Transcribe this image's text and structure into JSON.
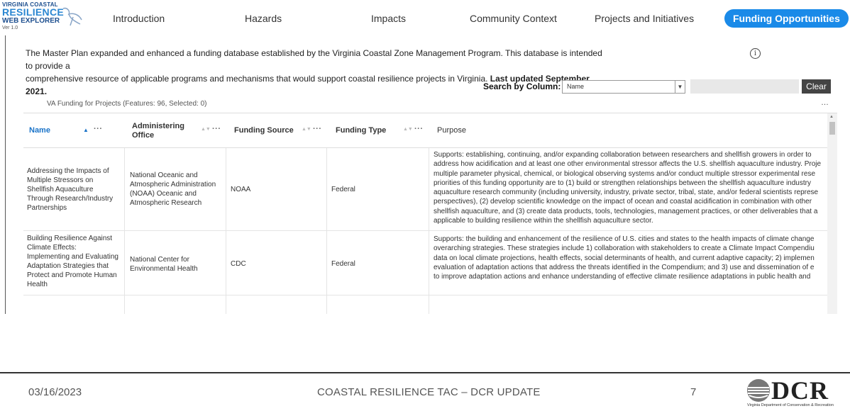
{
  "logo": {
    "line1": "VIRGINIA COASTAL",
    "line2": "RESILIENCE",
    "line3": "WEB EXPLORER",
    "version": "Ver 1.0"
  },
  "nav": {
    "tabs": [
      {
        "label": "Introduction"
      },
      {
        "label": "Hazards"
      },
      {
        "label": "Impacts"
      },
      {
        "label": "Community Context"
      },
      {
        "label": "Projects and Initiatives"
      },
      {
        "label": "Funding Opportunities",
        "active": true
      }
    ]
  },
  "intro": {
    "line1": "The Master Plan expanded and enhanced a funding database established by the Virginia Coastal Zone Management Program. This database is intended to provide a",
    "line2": "comprehensive resource of applicable programs and mechanisms that would support coastal resilience projects in Virginia.",
    "updated": "Last updated September 2021."
  },
  "info_icon": "info-icon",
  "search": {
    "label": "Search by Column:",
    "selected": "Name",
    "query": "",
    "clear_label": "Clear"
  },
  "table": {
    "feature_label": "VA Funding for Projects (Features: 96, Selected: 0)",
    "more_label": "…",
    "columns": [
      {
        "label": "Name",
        "sorted": "ascending"
      },
      {
        "label": "Administering Office"
      },
      {
        "label": "Funding Source"
      },
      {
        "label": "Funding Type"
      },
      {
        "label": "Purpose"
      }
    ],
    "rows": [
      {
        "name": "Addressing the Impacts of Multiple Stressors on Shellfish Aquaculture Through Research/Industry Partnerships",
        "office": "National Oceanic and Atmospheric Administration (NOAA) Oceanic and Atmospheric Research",
        "source": "NOAA",
        "type": "Federal",
        "purpose_lines": [
          "Supports: establishing, continuing, and/or expanding collaboration between researchers and shellfish growers in order to",
          "address how acidification and at least one other environmental stressor affects the U.S. shellfish aquaculture industry. Proje",
          "multiple parameter physical, chemical, or biological observing systems and/or conduct multiple stressor experimental rese",
          "priorities of this funding opportunity are to (1) build or strengthen relationships between the shellfish aquaculture industry",
          "aquaculture research community (including university, industry, private sector, tribal, state, and/or federal scientists represe",
          "perspectives), (2) develop scientific knowledge on the impact of ocean and coastal acidification in combination with other",
          "shellfish aquaculture, and (3) create data products, tools, technologies, management practices, or other deliverables that a",
          "applicable to building resilience within the shellfish aquaculture sector."
        ]
      },
      {
        "name": "Building Resilience Against Climate Effects: Implementing and Evaluating Adaptation Strategies that Protect and Promote Human Health",
        "office": "National Center for Environmental Health",
        "source": "CDC",
        "type": "Federal",
        "purpose_lines": [
          "Supports: the building and enhancement of the resilience of U.S. cities and states to the health impacts of climate change",
          "overarching strategies. These strategies include 1) collaboration with stakeholders to create a Climate Impact Compendiu",
          "data on local climate projections, health effects, social determinants of health, and current adaptive capacity; 2) implemen",
          "evaluation of adaptation actions that address the threats identified in the Compendium; and 3) use and dissemination of e",
          "to improve adaptation actions and enhance understanding of effective climate resilience adaptations in public health and"
        ]
      }
    ]
  },
  "footer": {
    "date": "03/16/2023",
    "title": "COASTAL RESILIENCE TAC – DCR UPDATE",
    "page": "7",
    "org_logo": "DCR",
    "org_name": "Virginia Department of Conservation & Recreation"
  }
}
